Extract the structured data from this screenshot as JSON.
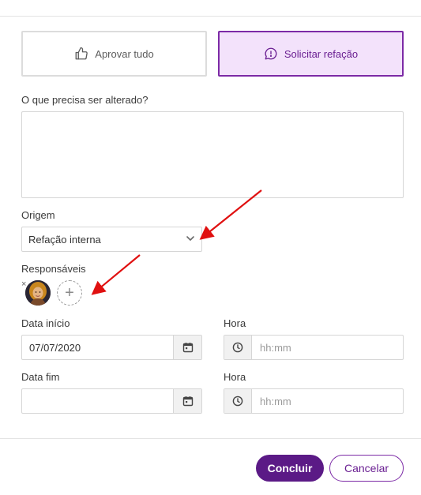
{
  "choices": {
    "approve_label": "Aprovar tudo",
    "approve_icon": "thumbs-up-icon",
    "refacao_label": "Solicitar refação",
    "refacao_icon": "message-alert-icon",
    "selected": "refacao"
  },
  "form": {
    "change_label": "O que precisa ser alterado?",
    "change_value": "",
    "origin_label": "Origem",
    "origin_value": "Refação interna",
    "responsibles_label": "Responsáveis",
    "remove_glyph": "×",
    "add_glyph": "+",
    "start_date_label": "Data início",
    "start_date_value": "07/07/2020",
    "start_time_label": "Hora",
    "start_time_placeholder": "hh:mm",
    "end_date_label": "Data fim",
    "end_date_value": "",
    "end_time_label": "Hora",
    "end_time_placeholder": "hh:mm"
  },
  "actions": {
    "confirm_label": "Concluir",
    "cancel_label": "Cancelar"
  },
  "colors": {
    "accent": "#5b1a86",
    "accent_light": "#f3e2fb",
    "annotation_arrow": "#e01010"
  }
}
